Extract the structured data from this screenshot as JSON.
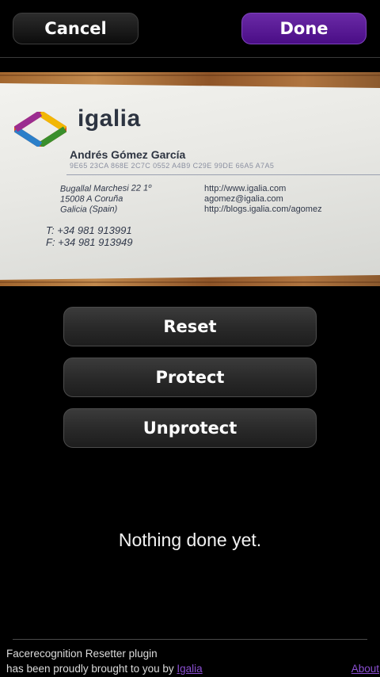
{
  "header": {
    "cancel_label": "Cancel",
    "done_label": "Done"
  },
  "photo": {
    "logo_text": "igalia",
    "name": "Andrés Gómez García",
    "key": "9E65 23CA 868E 2C7C 0552 A4B9 C29E 99DE 66A5 A7A5",
    "address": [
      "Bugallal Marchesi 22 1º",
      "15008 A Coruña",
      "Galicia (Spain)"
    ],
    "web": [
      "http://www.igalia.com",
      "agomez@igalia.com",
      "http://blogs.igalia.com/agomez"
    ],
    "phones": [
      "T: +34 981 913991",
      "F: +34 981 913949"
    ]
  },
  "actions": {
    "reset_label": "Reset",
    "protect_label": "Protect",
    "unprotect_label": "Unprotect"
  },
  "status_text": "Nothing done yet.",
  "footer": {
    "line1": "Facerecognition Resetter plugin",
    "line2_prefix": "has been proudly brought to you by ",
    "igalia_link": "Igalia",
    "about_link": "About"
  },
  "colors": {
    "accent": "#5a1a9a",
    "link": "#8b4fd3",
    "background": "#000000"
  }
}
